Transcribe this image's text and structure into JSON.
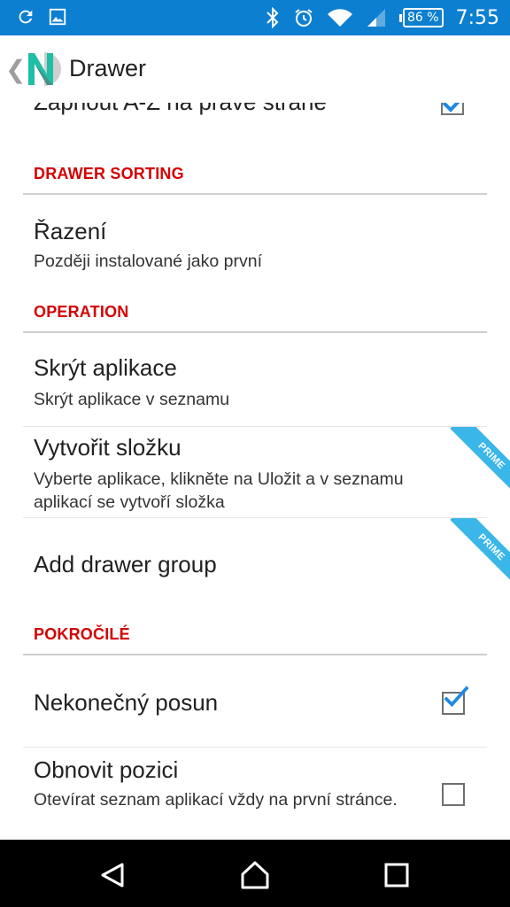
{
  "status_bar": {
    "battery_level": "86 %",
    "time": "7:55",
    "icons": [
      "sync-icon",
      "image-icon",
      "bluetooth-icon",
      "alarm-icon",
      "wifi-icon",
      "signal-icon",
      "battery-icon"
    ]
  },
  "toolbar": {
    "back_glyph": "❮",
    "logo_letter": "N",
    "title": "Drawer"
  },
  "clipped_item": {
    "title": "Zapnout A-Z na pravé straně",
    "checked": true
  },
  "sections": [
    {
      "header": "DRAWER SORTING",
      "items": [
        {
          "title": "Řazení",
          "summary": "Později instalované jako první"
        }
      ]
    },
    {
      "header": "OPERATION",
      "items": [
        {
          "title": "Skrýt aplikace",
          "summary": "Skrýt aplikace v seznamu"
        },
        {
          "title": "Vytvořit složku",
          "summary": "Vyberte aplikace, klikněte na Uložit a v seznamu aplikací se vytvoří složka",
          "badge": "PRIME"
        },
        {
          "title": "Add drawer group",
          "badge": "PRIME"
        }
      ]
    },
    {
      "header": "POKROČILÉ",
      "items": [
        {
          "title": "Nekonečný posun",
          "checked": true
        },
        {
          "title": "Obnovit pozici",
          "summary": "Otevírat seznam aplikací vždy na první stránce.",
          "checked": false
        }
      ]
    }
  ],
  "colors": {
    "status_bar": "#0c7fd0",
    "section_header": "#d50000",
    "prime_badge": "#3ab7e8",
    "checkmark": "#1e88e5"
  },
  "nav_bar": {
    "buttons": [
      "back-icon",
      "home-icon",
      "recents-icon"
    ]
  }
}
